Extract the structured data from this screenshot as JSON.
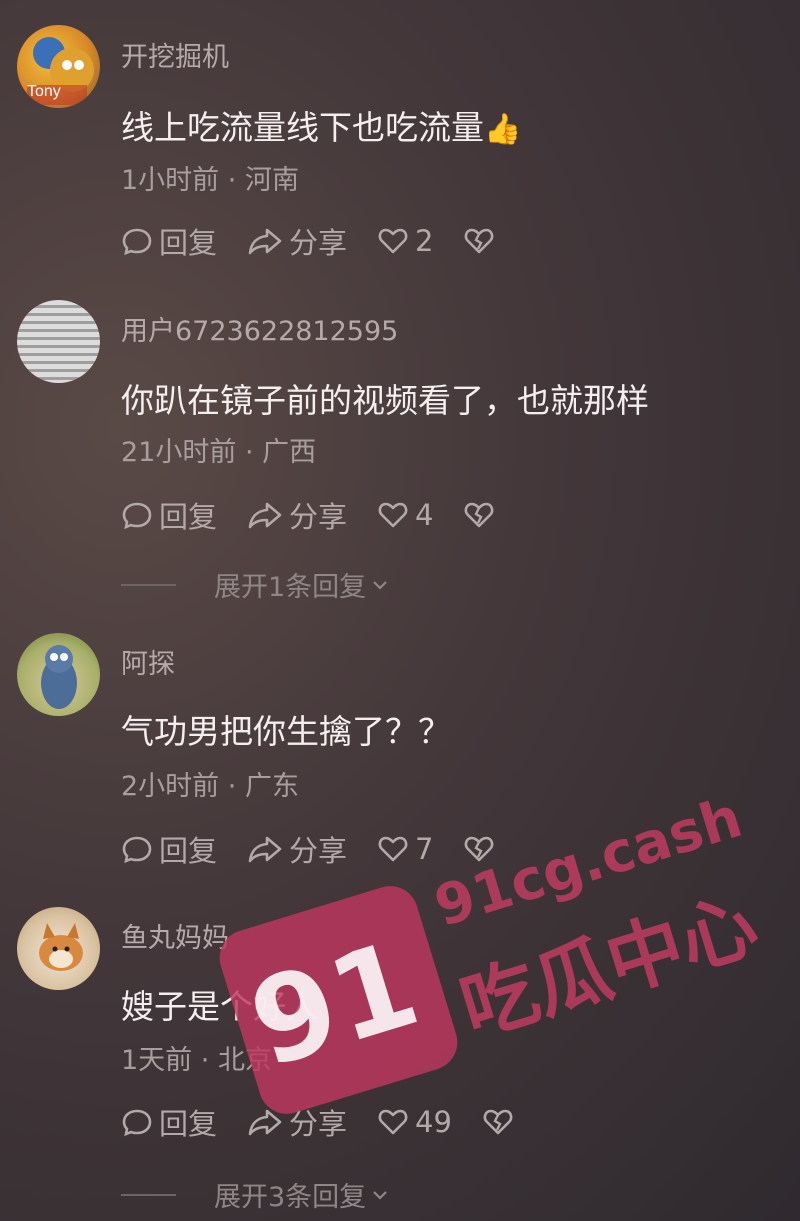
{
  "comments": [
    {
      "username": "开挖掘机",
      "text": "线上吃流量线下也吃流量",
      "emoji": "👍",
      "time": "1小时前",
      "location": "河南",
      "reply_label": "回复",
      "share_label": "分享",
      "likes": "2",
      "avatar_text": "Tony"
    },
    {
      "username": "用户6723622812595",
      "text": "你趴在镜子前的视频看了，也就那样",
      "time": "21小时前",
      "location": "广西",
      "reply_label": "回复",
      "share_label": "分享",
      "likes": "4",
      "expand_label": "展开1条回复"
    },
    {
      "username": "阿探",
      "text": "气功男把你生擒了？？",
      "time": "2小时前",
      "location": "广东",
      "reply_label": "回复",
      "share_label": "分享",
      "likes": "7"
    },
    {
      "username": "鱼丸妈妈",
      "text": "嫂子是个好人",
      "time": "1天前",
      "location": "北京",
      "reply_label": "回复",
      "share_label": "分享",
      "likes": "49",
      "expand_label": "展开3条回复"
    }
  ],
  "separator": "·",
  "watermark": {
    "number": "91",
    "site": "91cg.cash",
    "name": "吃瓜中心"
  },
  "icons": [
    "comment-icon",
    "share-icon",
    "heart-icon",
    "broken-heart-icon",
    "chevron-down-icon"
  ]
}
